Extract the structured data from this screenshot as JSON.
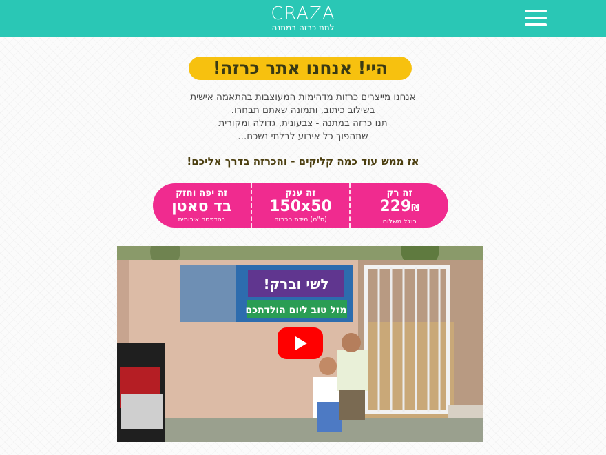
{
  "header": {
    "logo_title": "CRAZA",
    "logo_subtitle": "לתת כרזה במתנה",
    "menu_icon": "hamburger-menu-icon",
    "color": "#2ac7b5"
  },
  "headline": {
    "text": "היי! אנחנו אתר כרזה!",
    "color": "#f7c10f"
  },
  "intro": {
    "lines": [
      "אנחנו מייצרים כרזות מדהימות המעוצבות בהתאמה אישית",
      "בשילוב כיתוב, ותמונה שאתם תבחרו.",
      "תנו כרזה במתנה - צבעונית, גדולה ומקורית",
      "שתהפוך כל אירוע לבלתי נשכח..."
    ]
  },
  "cta": {
    "text": "אז ממש עוד כמה קליקים - והכרזה בדרך אליכם!"
  },
  "features": {
    "color": "#f02b8f",
    "items": [
      {
        "top": "זה רק",
        "big": "229",
        "currency": "₪",
        "small": "כולל משלוח"
      },
      {
        "top": "זה ענק",
        "big": "150x50",
        "currency": "",
        "small": "(ס\"מ) מידת הכרזה"
      },
      {
        "top": "זה יפה וחזק",
        "big": "בד סאטן",
        "currency": "",
        "small": "בהדפסה איכותית"
      }
    ]
  },
  "video": {
    "play_icon": "youtube-play-icon",
    "banner_line1": "לשי וברק!",
    "banner_line2": "מזל טוב ליום הולדתכם",
    "play_color": "#ff0000"
  }
}
